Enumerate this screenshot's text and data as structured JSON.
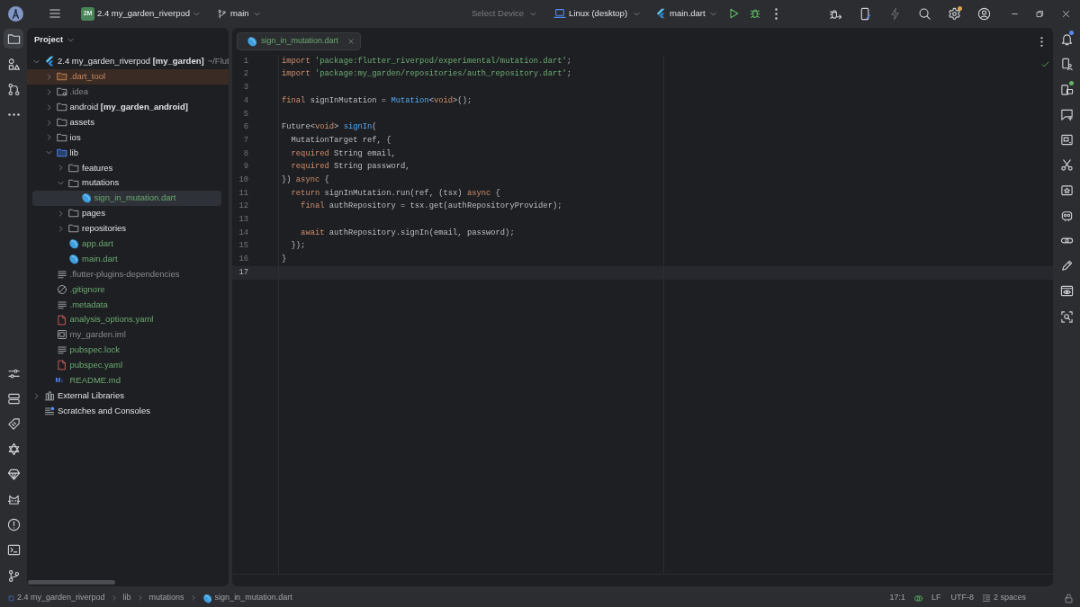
{
  "title_bar": {
    "project": {
      "badge": "2M",
      "name": "2.4 my_garden_riverpod"
    },
    "branch": "main",
    "device": {
      "label": "Select Device",
      "disabled": true
    },
    "target": "Linux (desktop)",
    "run_configuration": "main.dart",
    "actions": [
      {
        "kind": "debug-attach",
        "disabled": false
      },
      {
        "kind": "device-manager",
        "disabled": false
      },
      {
        "kind": "apply-changes",
        "disabled": true
      },
      {
        "kind": "search",
        "disabled": false
      },
      {
        "kind": "settings",
        "disabled": false,
        "color": "#e0a24b"
      },
      {
        "kind": "account",
        "disabled": false
      }
    ]
  },
  "left_toolbar": {
    "top": [
      {
        "kind": "project",
        "selected": true
      },
      {
        "kind": "structure",
        "selected": false
      },
      {
        "kind": "pull-requests",
        "selected": false
      },
      {
        "kind": "more",
        "selected": false
      }
    ],
    "bottom": [
      {
        "kind": "sliders",
        "selected": false
      },
      {
        "kind": "services",
        "selected": false
      },
      {
        "kind": "tag",
        "selected": false
      },
      {
        "kind": "hexagram",
        "selected": false
      },
      {
        "kind": "gem",
        "selected": false
      },
      {
        "kind": "logcat",
        "selected": false
      },
      {
        "kind": "problems",
        "selected": false
      },
      {
        "kind": "terminal",
        "selected": false
      },
      {
        "kind": "git",
        "selected": false
      }
    ]
  },
  "project_panel": {
    "title": "Project",
    "tree": [
      {
        "name": "2.4 my_garden_riverpod **[my_garden]**",
        "path": "~/Flut",
        "kind": "flutter-project",
        "added": false,
        "ignored": false,
        "excluded": false,
        "expanded": true,
        "selected": false,
        "children": [
          {
            "name": ".dart_tool",
            "kind": "folder",
            "added": false,
            "ignored": false,
            "excluded": true,
            "expanded": false,
            "selected": false
          },
          {
            "name": ".idea",
            "kind": "settings-folder",
            "added": false,
            "ignored": true,
            "excluded": false,
            "expanded": false,
            "selected": false
          },
          {
            "name": "android **[my_garden_android]**",
            "kind": "folder",
            "added": false,
            "ignored": false,
            "excluded": false,
            "expanded": false,
            "selected": false
          },
          {
            "name": "assets",
            "kind": "folder",
            "added": false,
            "ignored": false,
            "excluded": false,
            "expanded": false,
            "selected": false
          },
          {
            "name": "ios",
            "kind": "folder",
            "added": false,
            "ignored": false,
            "excluded": false,
            "expanded": false,
            "selected": false
          },
          {
            "name": "lib",
            "kind": "source-folder",
            "added": false,
            "ignored": false,
            "excluded": false,
            "expanded": true,
            "selected": false,
            "children": [
              {
                "name": "features",
                "kind": "folder",
                "added": false,
                "ignored": false,
                "excluded": false,
                "expanded": false,
                "selected": false
              },
              {
                "name": "mutations",
                "kind": "folder",
                "added": false,
                "ignored": false,
                "excluded": false,
                "expanded": true,
                "selected": false,
                "children": [
                  {
                    "name": "sign_in_mutation.dart",
                    "kind": "dart",
                    "added": true,
                    "ignored": false,
                    "excluded": false,
                    "selected": true
                  }
                ]
              },
              {
                "name": "pages",
                "kind": "folder",
                "added": false,
                "ignored": false,
                "excluded": false,
                "expanded": false,
                "selected": false
              },
              {
                "name": "repositories",
                "kind": "folder",
                "added": false,
                "ignored": false,
                "excluded": false,
                "expanded": false,
                "selected": false
              },
              {
                "name": "app.dart",
                "kind": "dart",
                "added": true,
                "ignored": false,
                "excluded": false,
                "selected": false
              },
              {
                "name": "main.dart",
                "kind": "dart",
                "added": true,
                "ignored": false,
                "excluded": false,
                "selected": false
              }
            ]
          },
          {
            "name": ".flutter-plugins-dependencies",
            "kind": "text",
            "added": false,
            "ignored": true,
            "excluded": false,
            "selected": false
          },
          {
            "name": ".gitignore",
            "kind": "ignore",
            "added": true,
            "ignored": false,
            "excluded": false,
            "selected": false
          },
          {
            "name": ".metadata",
            "kind": "text",
            "added": true,
            "ignored": false,
            "excluded": false,
            "selected": false
          },
          {
            "name": "analysis_options.yaml",
            "kind": "yaml",
            "added": true,
            "ignored": false,
            "excluded": false,
            "selected": false
          },
          {
            "name": "my_garden.iml",
            "kind": "module",
            "added": false,
            "ignored": true,
            "excluded": false,
            "selected": false
          },
          {
            "name": "pubspec.lock",
            "kind": "text",
            "added": true,
            "ignored": false,
            "excluded": false,
            "selected": false
          },
          {
            "name": "pubspec.yaml",
            "kind": "yaml",
            "added": true,
            "ignored": false,
            "excluded": false,
            "selected": false
          },
          {
            "name": "README.md",
            "kind": "markdown",
            "icon_text": "M↓",
            "added": true,
            "ignored": false,
            "excluded": false,
            "selected": false
          }
        ]
      },
      {
        "name": "External Libraries",
        "kind": "libraries",
        "added": false,
        "ignored": false,
        "excluded": false,
        "expanded": false,
        "selected": false
      },
      {
        "name": "Scratches and Consoles",
        "kind": "scratches",
        "added": false,
        "ignored": false,
        "excluded": false,
        "selected": false
      }
    ]
  },
  "editor": {
    "tabs": [
      {
        "name": "sign_in_mutation.dart",
        "kind": "dart",
        "added": true,
        "selected": true
      }
    ],
    "lines": [
      {
        "number": "1",
        "current": false,
        "tokens": [
          {
            "text": "import",
            "kind": "keyword"
          },
          {
            "text": " 'package:flutter_riverpod/experimental/mutation.dart'",
            "kind": "string"
          },
          {
            "text": ";",
            "kind": "plain"
          }
        ]
      },
      {
        "number": "2",
        "current": false,
        "tokens": [
          {
            "text": "import",
            "kind": "keyword"
          },
          {
            "text": " 'package:my_garden/repositories/auth_repository.dart'",
            "kind": "string"
          },
          {
            "text": ";",
            "kind": "plain"
          }
        ]
      },
      {
        "number": "3",
        "current": false
      },
      {
        "number": "4",
        "current": false,
        "tokens": [
          {
            "text": "final",
            "kind": "keyword"
          },
          {
            "text": " signInMutation = ",
            "kind": "plain"
          },
          {
            "text": "Mutation",
            "kind": "class"
          },
          {
            "text": "<",
            "kind": "plain"
          },
          {
            "text": "void",
            "kind": "keyword"
          },
          {
            "text": ">();",
            "kind": "plain"
          }
        ]
      },
      {
        "number": "5",
        "current": false
      },
      {
        "number": "6",
        "current": false,
        "tokens": [
          {
            "text": "Future<",
            "kind": "plain"
          },
          {
            "text": "void",
            "kind": "keyword"
          },
          {
            "text": "> ",
            "kind": "plain"
          },
          {
            "text": "signIn",
            "kind": "function"
          },
          {
            "text": "(",
            "kind": "plain"
          }
        ]
      },
      {
        "number": "7",
        "current": false,
        "tokens": [
          {
            "text": "  MutationTarget ref, {",
            "kind": "plain"
          }
        ]
      },
      {
        "number": "8",
        "current": false,
        "tokens": [
          {
            "text": "  required",
            "kind": "keyword"
          },
          {
            "text": " String email,",
            "kind": "plain"
          }
        ]
      },
      {
        "number": "9",
        "current": false,
        "tokens": [
          {
            "text": "  required",
            "kind": "keyword"
          },
          {
            "text": " String password,",
            "kind": "plain"
          }
        ]
      },
      {
        "number": "10",
        "current": false,
        "tokens": [
          {
            "text": "}) ",
            "kind": "plain"
          },
          {
            "text": "async",
            "kind": "keyword"
          },
          {
            "text": " {",
            "kind": "plain"
          }
        ]
      },
      {
        "number": "11",
        "current": false,
        "tokens": [
          {
            "text": "  return",
            "kind": "keyword"
          },
          {
            "text": " signInMutation.run(ref, (tsx) ",
            "kind": "plain"
          },
          {
            "text": "async",
            "kind": "keyword"
          },
          {
            "text": " {",
            "kind": "plain"
          }
        ]
      },
      {
        "number": "12",
        "current": false,
        "tokens": [
          {
            "text": "    final",
            "kind": "keyword"
          },
          {
            "text": " authRepository = tsx.get(authRepositoryProvider);",
            "kind": "plain"
          }
        ]
      },
      {
        "number": "13",
        "current": false
      },
      {
        "number": "14",
        "current": false,
        "tokens": [
          {
            "text": "    await",
            "kind": "keyword"
          },
          {
            "text": " authRepository.signIn(email, password);",
            "kind": "plain"
          }
        ]
      },
      {
        "number": "15",
        "current": false,
        "tokens": [
          {
            "text": "  });",
            "kind": "plain"
          }
        ]
      },
      {
        "number": "16",
        "current": false,
        "tokens": [
          {
            "text": "}",
            "kind": "plain"
          }
        ]
      },
      {
        "number": "17",
        "current": true
      }
    ]
  },
  "right_toolbar": [
    {
      "kind": "notifications",
      "selected": false,
      "color": "#548af7"
    },
    {
      "kind": "device-manager",
      "selected": false
    },
    {
      "kind": "running-devices",
      "selected": false,
      "color": "#5fb865"
    },
    {
      "kind": "chat-add",
      "selected": false
    },
    {
      "kind": "preview",
      "selected": false
    },
    {
      "kind": "scissors",
      "selected": false
    },
    {
      "kind": "frame-star",
      "selected": false
    },
    {
      "kind": "robot",
      "selected": false
    },
    {
      "kind": "link",
      "selected": false
    },
    {
      "kind": "pencil",
      "selected": false
    },
    {
      "kind": "window-eye",
      "selected": false
    },
    {
      "kind": "scan",
      "selected": false
    }
  ],
  "status_bar": {
    "breadcrumbs": [
      {
        "text": "2.4 my_garden_riverpod",
        "kind": "module"
      },
      {
        "text": "lib",
        "kind": "folder"
      },
      {
        "text": "mutations",
        "kind": "folder"
      },
      {
        "text": "sign_in_mutation.dart",
        "kind": "dart"
      }
    ],
    "caret_position": "17:1",
    "line_separator": "LF",
    "encoding": "UTF-8",
    "indent": "2 spaces"
  }
}
